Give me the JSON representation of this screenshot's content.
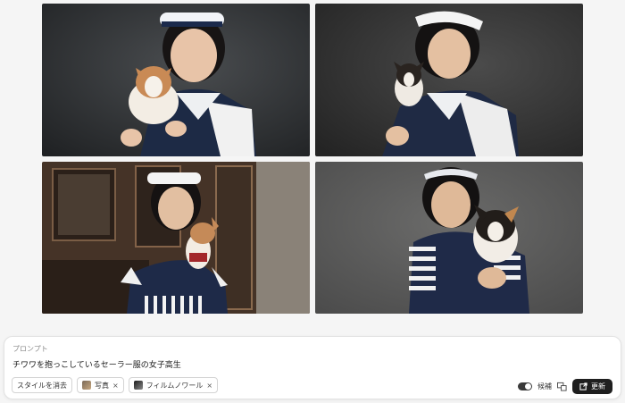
{
  "gallery": {
    "images": [
      {
        "name": "result-image-1"
      },
      {
        "name": "result-image-2"
      },
      {
        "name": "result-image-3"
      },
      {
        "name": "result-image-4"
      }
    ]
  },
  "prompt": {
    "label": "プロンプト",
    "text": "チワワを抱っこしているセーラー服の女子高生"
  },
  "styles": {
    "clear_label": "スタイルを消去",
    "chips": [
      {
        "label": "写真",
        "remove": "×"
      },
      {
        "label": "フィルムノワール",
        "remove": "×"
      }
    ]
  },
  "controls": {
    "candidates_label": "候補",
    "update_label": "更新"
  },
  "colors": {
    "accent": "#1f1f1f",
    "panel_bg": "#ffffff",
    "page_bg": "#f5f5f5"
  },
  "icons": {
    "update": "external-edit-icon",
    "compare": "compare-icon"
  }
}
